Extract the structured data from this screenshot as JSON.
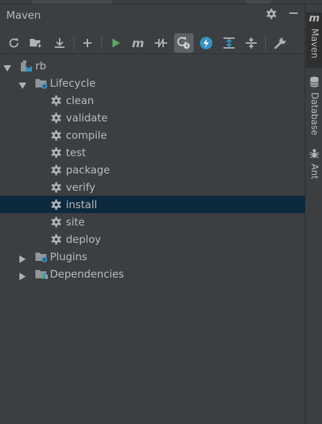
{
  "panel": {
    "title": "Maven",
    "header_icons": [
      "gear-icon",
      "minimize-icon"
    ]
  },
  "toolbar": {
    "buttons": [
      {
        "icon": "reload-icon"
      },
      {
        "icon": "add-folder-icon"
      },
      {
        "icon": "download-icon"
      },
      {
        "icon": "add-icon"
      },
      {
        "icon": "run-icon"
      },
      {
        "icon": "maven-goal-icon"
      },
      {
        "icon": "toggle-offline-icon"
      },
      {
        "icon": "skip-tests-icon",
        "active": true
      },
      {
        "icon": "show-dependencies-icon"
      },
      {
        "icon": "expand-all-icon"
      },
      {
        "icon": "collapse-all-icon"
      },
      {
        "icon": "settings-wrench-icon"
      }
    ]
  },
  "tree": {
    "project": "rb",
    "lifecycle": "Lifecycle",
    "goals": [
      "clean",
      "validate",
      "compile",
      "test",
      "package",
      "verify",
      "install",
      "site",
      "deploy"
    ],
    "selected_goal": "install",
    "plugins": "Plugins",
    "dependencies": "Dependencies"
  },
  "side_strip": {
    "tabs": [
      {
        "label": "Maven",
        "active": true
      },
      {
        "label": "Database",
        "active": false
      },
      {
        "label": "Ant",
        "active": false
      }
    ]
  },
  "colors": {
    "background": "#3c3f41",
    "selection": "#0d293e",
    "text": "#bbbbbb",
    "run_green": "#59a869",
    "accent_blue": "#3592c4"
  }
}
